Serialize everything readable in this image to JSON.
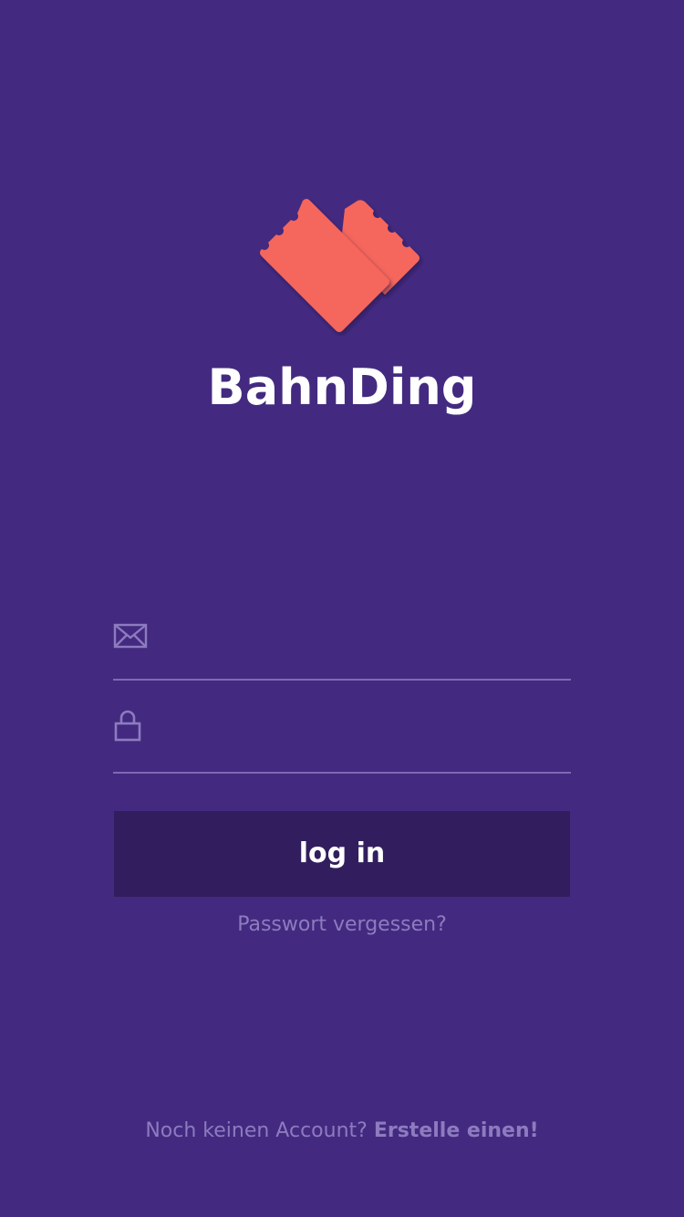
{
  "app": {
    "name": "BahnDing",
    "logo_icon": "heart-ticket-logo-icon"
  },
  "login_form": {
    "email_field": {
      "icon": "envelope-icon",
      "value": "",
      "placeholder": ""
    },
    "password_field": {
      "icon": "lock-icon",
      "value": "",
      "placeholder": ""
    },
    "login_button_label": "log in",
    "forgot_password_link": "Passwort vergessen?"
  },
  "signup": {
    "prompt": "Noch keinen Account?",
    "link_label": "Erstelle einen!"
  },
  "colors": {
    "background": "#432A80",
    "button_background": "#321E5E",
    "logo_accent": "#F5665C",
    "muted_text": "#8D7BBF",
    "field_underline": "#7E69B3"
  }
}
